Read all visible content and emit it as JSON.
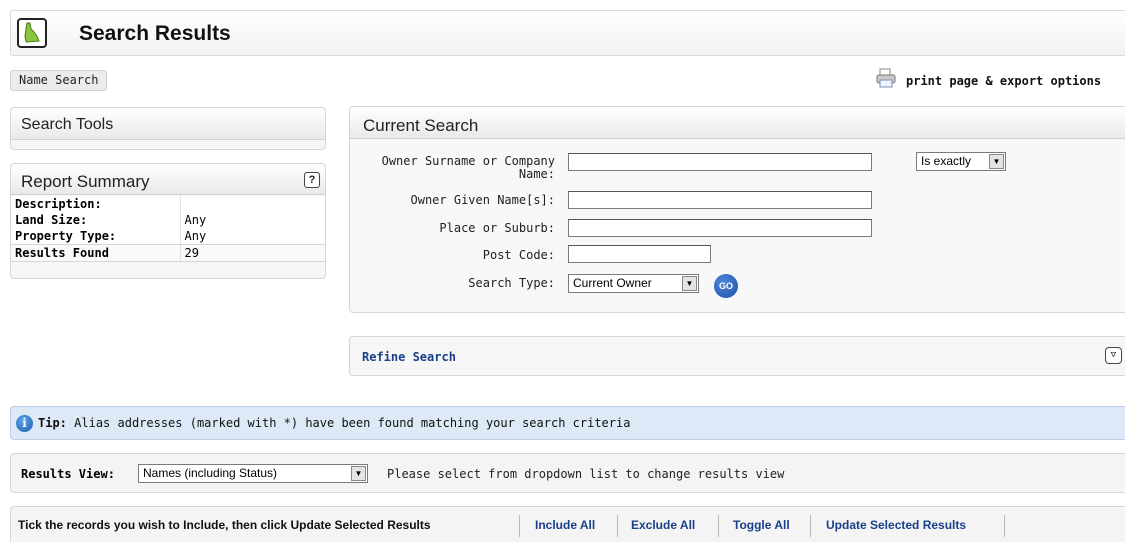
{
  "header": {
    "title": "Search Results",
    "logo_icon": "state-map-icon"
  },
  "tabs": {
    "active": "Name Search"
  },
  "print": {
    "label": "print page & export options",
    "icon": "printer-icon"
  },
  "search_tools": {
    "title": "Search Tools"
  },
  "report_summary": {
    "title": "Report Summary",
    "help": "?",
    "rows": [
      {
        "label": "Description:",
        "value": ""
      },
      {
        "label": "Land Size:",
        "value": "Any"
      },
      {
        "label": "Property Type:",
        "value": "Any"
      },
      {
        "label": "Results Found",
        "value": "29"
      }
    ]
  },
  "current_search": {
    "title": "Current Search",
    "surname_label_1": "Owner Surname or Company",
    "surname_label_2": "Name:",
    "surname_value": "",
    "match_select": "Is exactly",
    "given_label": "Owner Given Name[s]:",
    "given_value": "",
    "place_label": "Place or Suburb:",
    "place_value": "",
    "postcode_label": "Post Code:",
    "postcode_value": "",
    "type_label": "Search Type:",
    "type_select": "Current Owner",
    "go_label": "GO"
  },
  "refine": {
    "label": "Refine Search",
    "toggle": "▽"
  },
  "tip": {
    "prefix": "Tip:",
    "text": "Alias addresses (marked with *) have been found matching your search criteria"
  },
  "results_view": {
    "label": "Results View:",
    "selected": "Names (including Status)",
    "hint": "Please select from dropdown list to change results view"
  },
  "records_bar": {
    "instruction": "Tick the records you wish to Include, then click Update Selected Results",
    "include_all": "Include All",
    "exclude_all": "Exclude All",
    "toggle_all": "Toggle All",
    "update": "Update Selected Results"
  },
  "colors": {
    "link": "#1a3f8a",
    "tip_bg": "#dde9f6",
    "go_button": "#1a4fa8"
  }
}
